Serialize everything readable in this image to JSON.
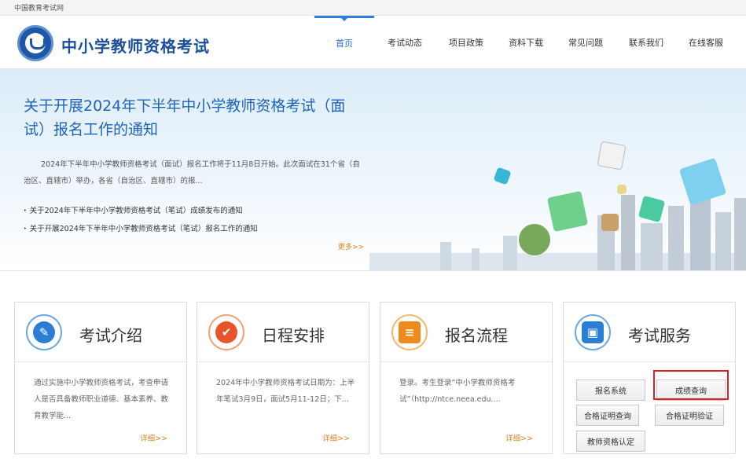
{
  "topbar": {
    "site": "中国教育考试网"
  },
  "header": {
    "title": "中小学教师资格考试"
  },
  "nav": [
    {
      "label": "首页",
      "active": true
    },
    {
      "label": "考试动态"
    },
    {
      "label": "项目政策"
    },
    {
      "label": "资料下载"
    },
    {
      "label": "常见问题"
    },
    {
      "label": "联系我们"
    },
    {
      "label": "在线客服"
    }
  ],
  "banner": {
    "title": "关于开展2024年下半年中小学教师资格考试（面试）报名工作的通知",
    "summary": "2024年下半年中小学教师资格考试（面试）报名工作将于11月8日开始。此次面试在31个省（自治区、直辖市）举办，各省（自治区、直辖市）的报...",
    "links": [
      "关于2024年下半年中小学教师资格考试（笔试）成绩发布的通知",
      "关于开展2024年下半年中小学教师资格考试（笔试）报名工作的通知"
    ],
    "more": "更多>>"
  },
  "cards": [
    {
      "title": "考试介绍",
      "icon": "document-edit-icon",
      "color": "#2a7fd4",
      "body": "通过实施中小学教师资格考试，考查申请人是否具备教师职业道德、基本素养、教育教学能...",
      "more": "详细>>"
    },
    {
      "title": "日程安排",
      "icon": "checkmark-icon",
      "color": "#e8532a",
      "body": "2024年中小学教师资格考试日期为：上半年笔试3月9日，面试5月11-12日；下...",
      "more": "详细>>"
    },
    {
      "title": "报名流程",
      "icon": "form-edit-icon",
      "color": "#f08a1c",
      "body": "登录。考生登录“中小学教师资格考试”（http://ntce.neea.edu....",
      "more": "详细>>"
    },
    {
      "title": "考试服务",
      "icon": "contact-book-icon",
      "color": "#2a7fd4",
      "buttons": [
        "报名系统",
        "成绩查询",
        "合格证明查询",
        "合格证明验证",
        "教师资格认定"
      ],
      "highlighted": "成绩查询"
    }
  ]
}
